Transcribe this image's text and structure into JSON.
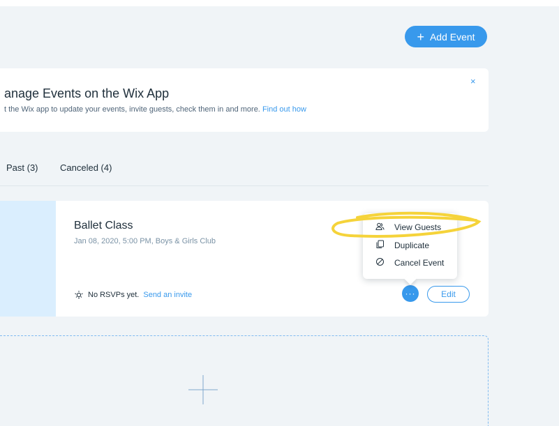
{
  "header": {
    "add_event_label": "Add Event"
  },
  "banner": {
    "title": "anage Events on the Wix App",
    "text": "t the Wix app to update your events, invite guests, check them in and more.",
    "link": "Find out how",
    "close": "×"
  },
  "tabs": [
    {
      "label": "Past (3)"
    },
    {
      "label": "Canceled (4)"
    }
  ],
  "event": {
    "title": "Ballet Class",
    "meta": "Jan 08, 2020, 5:00 PM, Boys & Girls Club",
    "rsvp_text": "No RSVPs yet.",
    "rsvp_link": "Send an invite",
    "more_label": "···",
    "edit_label": "Edit"
  },
  "menu": {
    "items": [
      {
        "label": "View Guests",
        "icon": "guests-icon"
      },
      {
        "label": "Duplicate",
        "icon": "duplicate-icon"
      },
      {
        "label": "Cancel Event",
        "icon": "cancel-icon"
      }
    ]
  },
  "colors": {
    "accent": "#3899ec",
    "background": "#f0f4f7",
    "highlight": "#f5d33a",
    "image_placeholder": "#daeefe"
  }
}
